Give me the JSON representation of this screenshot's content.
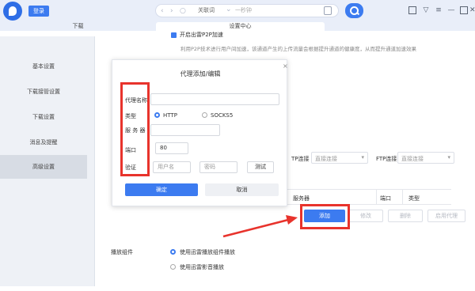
{
  "titlebar": {
    "login_label": "登录",
    "search_text": "关联词",
    "search_placeholder": "一秒钟",
    "nav_back": "‹",
    "nav_forward": "›",
    "nav_reload": "○",
    "nav_dropdown": "⌄",
    "win_skin": "▽",
    "win_menu": "≡",
    "win_min": "—",
    "win_close": "✕"
  },
  "tabs": [
    {
      "label": "下载"
    },
    {
      "label": "设置中心"
    }
  ],
  "sidebar": {
    "items": [
      {
        "label": "基本设置"
      },
      {
        "label": "下载接管设置"
      },
      {
        "label": "下载设置"
      },
      {
        "label": "消息及提醒"
      },
      {
        "label": "高级设置"
      }
    ]
  },
  "main": {
    "p2p_label": "开启出雷P2P加速",
    "p2p_desc": "利用P2P技术进行用户间加速，该通道产生的上传流量会根据提升通道的健康度，从而提升通道加速效果",
    "ftp_connect_1_label": "TP连接",
    "ftp_connect_1_value": "直接连接",
    "ftp_connect_2_label": "FTP连接",
    "ftp_connect_2_value": "直接连接",
    "select_caret": "▾",
    "proxy_table_headers": [
      "服务器",
      "端口",
      "类型"
    ],
    "buttons": {
      "add": "添加",
      "edit": "修改",
      "delete": "删除",
      "apply": "启用代理"
    },
    "player_label": "播放组件",
    "player_options": [
      "使用迅雷播放组件播放",
      "使用迅雷影音播放"
    ]
  },
  "modal": {
    "title": "代理添加/编辑",
    "close": "×",
    "name_label": "代理名称",
    "type_label": "类型",
    "type_options": [
      "HTTP",
      "SOCKS5"
    ],
    "server_label": "服 务 器",
    "port_label": "端口",
    "port_value": "80",
    "auth_label": "验证",
    "username_placeholder": "用户名",
    "password_placeholder": "密码",
    "test_label": "测试",
    "ok_label": "确定",
    "cancel_label": "取消"
  },
  "colors": {
    "accent": "#3c7bf0",
    "highlight": "#e8332c"
  }
}
